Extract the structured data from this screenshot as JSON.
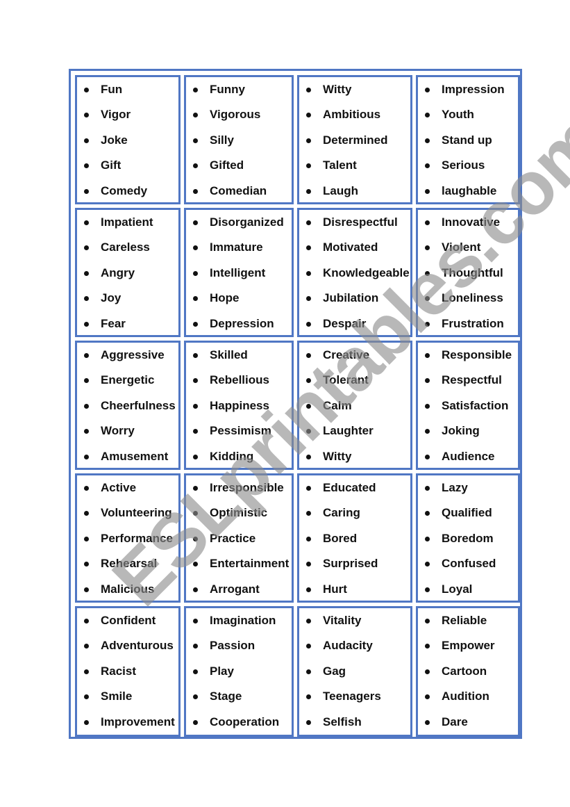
{
  "watermark": "ESLprintables.com",
  "colors": {
    "border": "#5077c4",
    "text": "#111111",
    "watermark": "#8c8c8c"
  },
  "cards": [
    [
      "Fun",
      "Vigor",
      "Joke",
      "Gift",
      "Comedy"
    ],
    [
      "Funny",
      "Vigorous",
      "Silly",
      "Gifted",
      "Comedian"
    ],
    [
      "Witty",
      "Ambitious",
      "Determined",
      "Talent",
      "Laugh"
    ],
    [
      "Impression",
      "Youth",
      "Stand up",
      "Serious",
      "laughable"
    ],
    [
      "Impatient",
      "Careless",
      "Angry",
      "Joy",
      "Fear"
    ],
    [
      "Disorganized",
      "Immature",
      "Intelligent",
      "Hope",
      "Depression"
    ],
    [
      "Disrespectful",
      "Motivated",
      "Knowledgeable",
      "Jubilation",
      "Despair"
    ],
    [
      "Innovative",
      "Violent",
      "Thoughtful",
      "Loneliness",
      "Frustration"
    ],
    [
      "Aggressive",
      "Energetic",
      "Cheerfulness",
      "Worry",
      " Amusement"
    ],
    [
      "Skilled",
      "Rebellious",
      "Happiness",
      "Pessimism",
      "Kidding"
    ],
    [
      "Creative",
      "Tolerant",
      "Calm",
      "Laughter",
      "Witty"
    ],
    [
      "Responsible",
      "Respectful",
      "Satisfaction",
      "Joking",
      "Audience"
    ],
    [
      "Active",
      "Volunteering",
      "Performance",
      "Rehearsal",
      "Malicious"
    ],
    [
      "Irresponsible",
      "Optimistic",
      "Practice",
      "Entertainment",
      "Arrogant"
    ],
    [
      "Educated",
      "Caring",
      "Bored",
      "Surprised",
      "Hurt"
    ],
    [
      "Lazy",
      "Qualified",
      "Boredom",
      "Confused",
      "Loyal"
    ],
    [
      "Confident",
      "Adventurous",
      "Racist",
      "Smile",
      "Improvement"
    ],
    [
      "Imagination",
      "Passion",
      "Play",
      "Stage",
      "Cooperation"
    ],
    [
      "Vitality",
      "Audacity",
      "Gag",
      "Teenagers",
      "Selfish"
    ],
    [
      "Reliable",
      "Empower",
      "Cartoon",
      "Audition",
      "Dare"
    ]
  ]
}
